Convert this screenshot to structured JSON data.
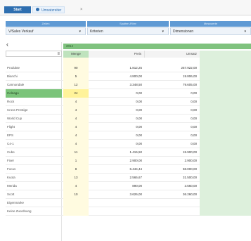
{
  "tabbar": {
    "button_label": "Start",
    "tab_label": "Umsatzreiter",
    "close_label": "×"
  },
  "headers": {
    "h1": "Zeilen",
    "h2": "Spalten-Filter",
    "h3": "Messwerte"
  },
  "filters": {
    "f1": "V/Sales Verkauf",
    "f2": "Kriterien",
    "f3": "Dimensionen"
  },
  "group_header": "2014",
  "columns": {
    "menge": "Menge",
    "preis": "Preis",
    "umsatz": "Umsatz"
  },
  "rows": [
    {
      "label": "Produkte",
      "menge": "90",
      "preis": "1.812,25",
      "umsatz": "257.922,00",
      "hl": false
    },
    {
      "label": "Bianchi",
      "menge": "5",
      "preis": "4.800,00",
      "umsatz": "19.806,00",
      "hl": false
    },
    {
      "label": "Cannondale",
      "menge": "12",
      "preis": "3.348,50",
      "umsatz": "79.605,00",
      "hl": false
    },
    {
      "label": "Colnago",
      "menge": "24",
      "preis": "0,00",
      "umsatz": "0,00",
      "hl": true
    },
    {
      "label": "Rock",
      "menge": "4",
      "preis": "0,00",
      "umsatz": "0,00",
      "hl": false
    },
    {
      "label": "Cross Prestige",
      "menge": "4",
      "preis": "0,00",
      "umsatz": "0,00",
      "hl": false
    },
    {
      "label": "World Cup",
      "menge": "4",
      "preis": "0,00",
      "umsatz": "0,00",
      "hl": false
    },
    {
      "label": "Flight",
      "menge": "4",
      "preis": "0,00",
      "umsatz": "0,00",
      "hl": false
    },
    {
      "label": "EPS",
      "menge": "4",
      "preis": "0,00",
      "umsatz": "0,00",
      "hl": false
    },
    {
      "label": "C4-1",
      "menge": "4",
      "preis": "0,00",
      "umsatz": "0,00",
      "hl": false
    },
    {
      "label": "Cube",
      "menge": "11",
      "preis": "1.415,50",
      "umsatz": "15.900,00",
      "hl": false
    },
    {
      "label": "Fixer",
      "menge": "1",
      "preis": "2.900,00",
      "umsatz": "2.900,00",
      "hl": false
    },
    {
      "label": "Focus",
      "menge": "8",
      "preis": "6.444,44",
      "umsatz": "58.000,00",
      "hl": false
    },
    {
      "label": "Kuota",
      "menge": "13",
      "preis": "2.565,67",
      "umsatz": "31.500,00",
      "hl": false
    },
    {
      "label": "Merida",
      "menge": "4",
      "preis": "890,00",
      "umsatz": "3.560,00",
      "hl": false
    },
    {
      "label": "Scott",
      "menge": "10",
      "preis": "3.626,00",
      "umsatz": "36.260,00",
      "hl": false
    },
    {
      "label": "Eigenmarke",
      "menge": "",
      "preis": "",
      "umsatz": "",
      "hl": false
    },
    {
      "label": "Keine Zuordnung",
      "menge": "",
      "preis": "",
      "umsatz": "",
      "hl": false
    }
  ]
}
